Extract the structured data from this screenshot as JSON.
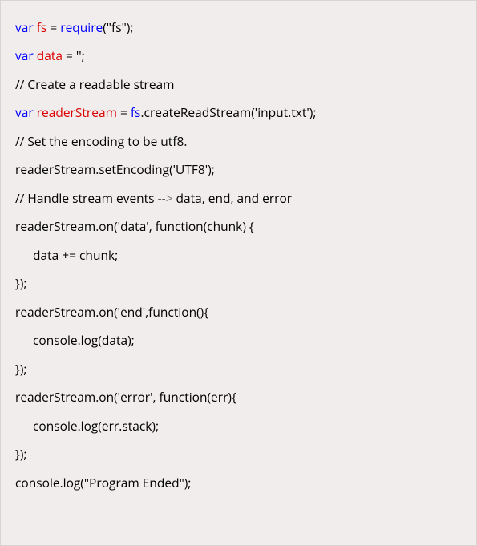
{
  "lines": [
    {
      "tokens": [
        {
          "t": "var ",
          "c": "kw"
        },
        {
          "t": "fs",
          "c": "decl"
        },
        {
          "t": " = ",
          "c": ""
        },
        {
          "t": "require",
          "c": "kw"
        },
        {
          "t": "(\"fs\");",
          "c": ""
        }
      ]
    },
    {
      "tokens": [
        {
          "t": "var ",
          "c": "kw"
        },
        {
          "t": "data",
          "c": "decl"
        },
        {
          "t": " = '';",
          "c": ""
        }
      ]
    },
    {
      "tokens": [
        {
          "t": "// Create a readable stream",
          "c": ""
        }
      ]
    },
    {
      "tokens": [
        {
          "t": "var ",
          "c": "kw"
        },
        {
          "t": "readerStream",
          "c": "decl"
        },
        {
          "t": " = ",
          "c": ""
        },
        {
          "t": "fs",
          "c": "kw"
        },
        {
          "t": ".createReadStream('input.txt');",
          "c": ""
        }
      ]
    },
    {
      "tokens": [
        {
          "t": "// Set the encoding to be utf8.",
          "c": ""
        }
      ]
    },
    {
      "tokens": [
        {
          "t": "readerStream.setEncoding('UTF8');",
          "c": ""
        }
      ]
    },
    {
      "tokens": [
        {
          "t": "// Handle stream events --",
          "c": ""
        },
        {
          "t": ">",
          "c": "gray"
        },
        {
          "t": " data, end, and error",
          "c": ""
        }
      ]
    },
    {
      "tokens": [
        {
          "t": "readerStream.on('data', function(chunk) {",
          "c": ""
        }
      ]
    },
    {
      "indent": true,
      "tokens": [
        {
          "t": "data += chunk;",
          "c": ""
        }
      ]
    },
    {
      "tokens": [
        {
          "t": "});",
          "c": ""
        }
      ]
    },
    {
      "tokens": [
        {
          "t": "readerStream.on('end',function(){",
          "c": ""
        }
      ]
    },
    {
      "indent": true,
      "tokens": [
        {
          "t": "console.log(data);",
          "c": ""
        }
      ]
    },
    {
      "tokens": [
        {
          "t": "});",
          "c": ""
        }
      ]
    },
    {
      "tokens": [
        {
          "t": "readerStream.on('error', function(err){",
          "c": ""
        }
      ]
    },
    {
      "indent": true,
      "tokens": [
        {
          "t": "console.log(err.stack);",
          "c": ""
        }
      ]
    },
    {
      "tokens": [
        {
          "t": "});",
          "c": ""
        }
      ]
    },
    {
      "tokens": [
        {
          "t": "console.log(\"Program Ended\");",
          "c": ""
        }
      ]
    }
  ]
}
